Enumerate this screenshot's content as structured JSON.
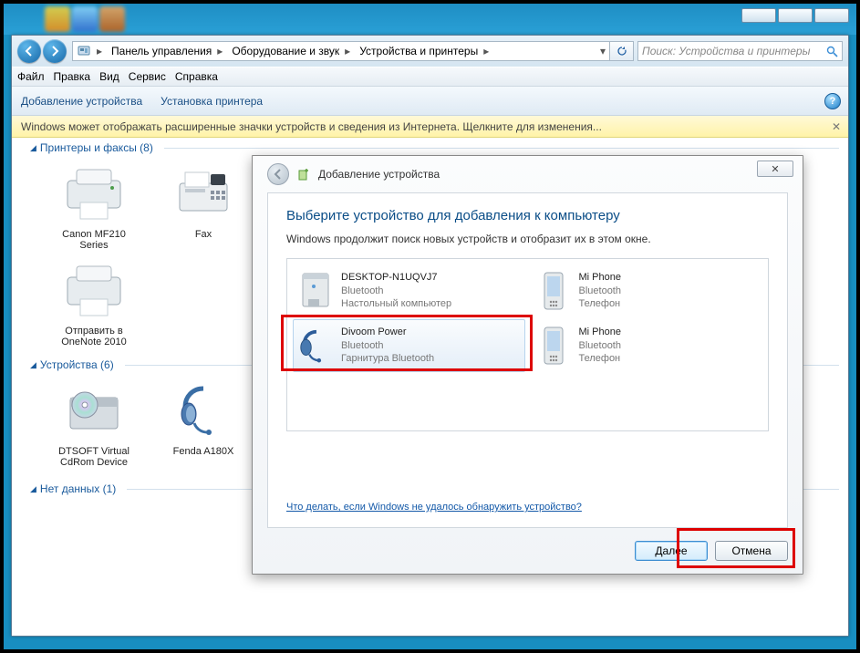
{
  "breadcrumb": [
    "Панель управления",
    "Оборудование и звук",
    "Устройства и принтеры"
  ],
  "search_placeholder": "Поиск: Устройства и принтеры",
  "menu": [
    "Файл",
    "Правка",
    "Вид",
    "Сервис",
    "Справка"
  ],
  "toolbar": {
    "add": "Добавление устройства",
    "printer": "Установка принтера"
  },
  "infobar": "Windows может отображать расширенные значки устройств и сведения из Интернета.   Щелкните для изменения...",
  "sections": {
    "printers": {
      "title": "Принтеры и факсы (8)",
      "items": [
        "Canon MF210 Series",
        "Fax",
        "Отправить в OneNote 2010"
      ]
    },
    "devices": {
      "title": "Устройства (6)",
      "items": [
        "DTSOFT Virtual CdRom Device",
        "Fenda A180X"
      ]
    },
    "nodata": {
      "title": "Нет данных (1)"
    }
  },
  "dialog": {
    "title": "Добавление устройства",
    "heading": "Выберите устройство для добавления к компьютеру",
    "sub": "Windows продолжит поиск новых устройств и отобразит их в этом окне.",
    "devices": [
      {
        "name": "DESKTOP-N1UQVJ7",
        "type": "Bluetooth",
        "sub": "Настольный компьютер",
        "icon": "computer"
      },
      {
        "name": "Mi Phone",
        "type": "Bluetooth",
        "sub": "Телефон",
        "icon": "phone"
      },
      {
        "name": "Divoom Power",
        "type": "Bluetooth",
        "sub": "Гарнитура Bluetooth",
        "icon": "headset",
        "selected": true
      },
      {
        "name": "Mi Phone",
        "type": "Bluetooth",
        "sub": "Телефон",
        "icon": "phone"
      }
    ],
    "help_link": "Что делать, если Windows не удалось обнаружить устройство?",
    "next": "Далее",
    "cancel": "Отмена"
  }
}
